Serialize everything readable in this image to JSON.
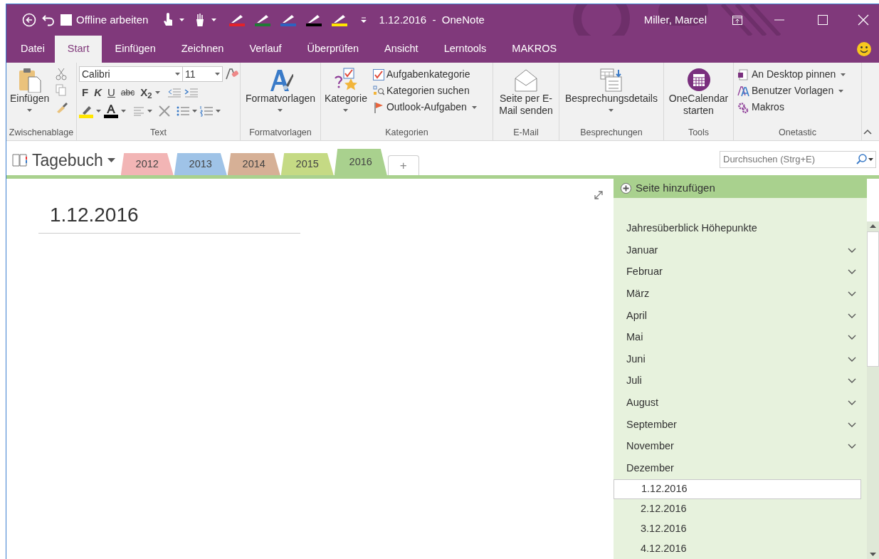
{
  "quick_access": {
    "offline": {
      "label": "Offline arbeiten",
      "checked": false
    },
    "pens": [
      {
        "color": "#e3222b"
      },
      {
        "color": "#1f7a35"
      },
      {
        "color": "#2e62c0"
      },
      {
        "color": "#000000"
      },
      {
        "color": "#ffe600"
      }
    ]
  },
  "window": {
    "title": "1.12.2016  -  OneNote",
    "user": "Miller, Marcel"
  },
  "ribbon_tabs": [
    {
      "label": "Datei",
      "selected": false
    },
    {
      "label": "Start",
      "selected": true
    },
    {
      "label": "Einfügen",
      "selected": false
    },
    {
      "label": "Zeichnen",
      "selected": false
    },
    {
      "label": "Verlauf",
      "selected": false
    },
    {
      "label": "Überprüfen",
      "selected": false
    },
    {
      "label": "Ansicht",
      "selected": false
    },
    {
      "label": "Lerntools",
      "selected": false
    },
    {
      "label": "MAKROS",
      "selected": false
    }
  ],
  "ribbon": {
    "groups": [
      {
        "kind": "clipboard",
        "label": "Zwischenablage",
        "button": "Einfügen",
        "dropdown": true
      },
      {
        "kind": "text",
        "label": "Text",
        "font": "Calibri",
        "size": "11",
        "styles": [
          "F",
          "K",
          "U",
          "abc",
          "X$_{2}$"
        ]
      },
      {
        "kind": "big",
        "label": "Formatvorlagen",
        "button": "Formatvorlagen",
        "dropdown": true
      },
      {
        "kind": "categories",
        "label": "Kategorien",
        "button": "Kategorie",
        "dropdown": true,
        "items": [
          {
            "label": "Aufgabenkategorie",
            "dropdown": false
          },
          {
            "label": "Kategorien suchen",
            "dropdown": false
          },
          {
            "label": "Outlook-Aufgaben",
            "dropdown": true
          }
        ]
      },
      {
        "kind": "big",
        "label": "E-Mail",
        "button": "Seite per E-Mail senden",
        "dropdown": false
      },
      {
        "kind": "big",
        "label": "Besprechungen",
        "button": "Besprechungsdetails",
        "dropdown": true
      },
      {
        "kind": "big",
        "label": "Tools",
        "button": "OneCalendar starten",
        "dropdown": false
      },
      {
        "kind": "list",
        "label": "Onetastic",
        "items": [
          {
            "label": "An Desktop pinnen",
            "dropdown": true
          },
          {
            "label": "Benutzer Vorlagen",
            "dropdown": true
          },
          {
            "label": "Makros",
            "dropdown": false
          }
        ]
      }
    ]
  },
  "notebook": {
    "name": "Tagebuch",
    "sections": [
      {
        "label": "2012",
        "color": "#f2b5b5",
        "selected": false
      },
      {
        "label": "2013",
        "color": "#9fc3e7",
        "selected": false
      },
      {
        "label": "2014",
        "color": "#d6b096",
        "selected": false
      },
      {
        "label": "2015",
        "color": "#c5da84",
        "selected": false
      },
      {
        "label": "2016",
        "color": "#a9d18e",
        "selected": true
      }
    ],
    "add_section": "+"
  },
  "search": {
    "placeholder": "Durchsuchen (Strg+E)"
  },
  "page": {
    "title": "1.12.2016"
  },
  "pages": {
    "add_page": "Seite hinzufügen",
    "items": [
      {
        "label": "Jahresüberblick Höhepunkte",
        "selected": false
      },
      {
        "label": "Januar",
        "selected": false,
        "expanded": false
      },
      {
        "label": "Februar",
        "selected": false,
        "expanded": false
      },
      {
        "label": "März",
        "selected": false,
        "expanded": false
      },
      {
        "label": "April",
        "selected": false,
        "expanded": false
      },
      {
        "label": "Mai",
        "selected": false,
        "expanded": false
      },
      {
        "label": "Juni",
        "selected": false,
        "expanded": false
      },
      {
        "label": "Juli",
        "selected": false,
        "expanded": false
      },
      {
        "label": "August",
        "selected": false,
        "expanded": false
      },
      {
        "label": "September",
        "selected": false,
        "expanded": false
      },
      {
        "label": "November",
        "selected": false,
        "expanded": false
      },
      {
        "label": "Dezember",
        "selected": false,
        "expanded": true,
        "children": [
          {
            "label": "1.12.2016",
            "selected": true
          },
          {
            "label": "2.12.2016",
            "selected": false
          },
          {
            "label": "3.12.2016",
            "selected": false
          },
          {
            "label": "4.12.2016",
            "selected": false
          }
        ]
      }
    ]
  }
}
